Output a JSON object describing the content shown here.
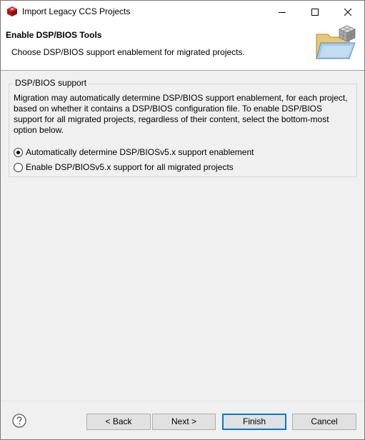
{
  "window": {
    "title": "Import Legacy CCS Projects",
    "app_icon": "ccs-cube-icon"
  },
  "banner": {
    "title": "Enable DSP/BIOS Tools",
    "description": "Choose DSP/BIOS support enablement for migrated projects.",
    "image": "folder-cube-wizard-icon"
  },
  "group": {
    "label": "DSP/BIOS support",
    "description": "Migration may automatically determine DSP/BIOS support enablement, for each project, based on whether it contains a DSP/BIOS configuration file. To enable DSP/BIOS support for all migrated projects, regardless of their content, select the bottom-most option below.",
    "options": [
      {
        "label": "Automatically determine DSP/BIOSv5.x support enablement",
        "selected": true
      },
      {
        "label": "Enable DSP/BIOSv5.x support for all migrated projects",
        "selected": false
      }
    ]
  },
  "buttons": {
    "help_icon": "help-icon",
    "back": "< Back",
    "next": "Next >",
    "finish": "Finish",
    "cancel": "Cancel"
  },
  "colors": {
    "app_icon_red": "#c4161c",
    "default_button_border": "#0078d7",
    "dialog_bg": "#f0f0f0"
  }
}
